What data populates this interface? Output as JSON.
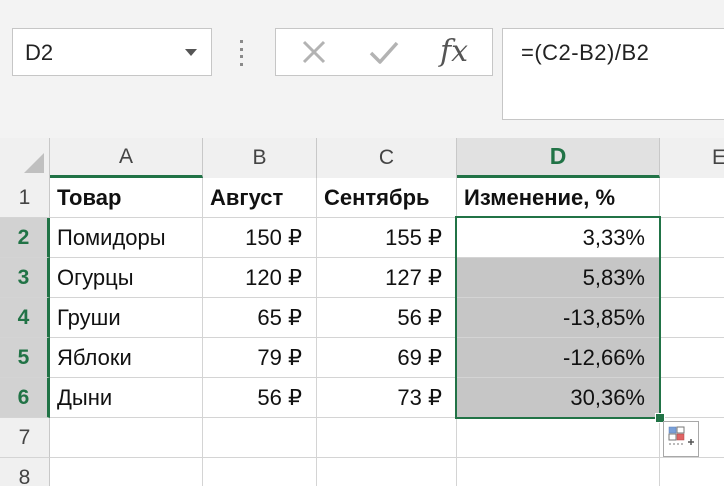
{
  "name_box": {
    "value": "D2"
  },
  "formula_bar": {
    "formula": "=(C2-B2)/B2",
    "cancel_icon": "cancel-x-icon",
    "enter_icon": "check-icon",
    "function_label": "fx"
  },
  "columns": [
    {
      "letter": "A"
    },
    {
      "letter": "B"
    },
    {
      "letter": "C"
    },
    {
      "letter": "D"
    },
    {
      "letter": "E"
    }
  ],
  "rows": [
    {
      "number": "1"
    },
    {
      "number": "2"
    },
    {
      "number": "3"
    },
    {
      "number": "4"
    },
    {
      "number": "5"
    },
    {
      "number": "6"
    },
    {
      "number": "7"
    },
    {
      "number": "8"
    }
  ],
  "table": {
    "headers": [
      "Товар",
      "Август",
      "Сентябрь",
      "Изменение, %"
    ],
    "data": [
      [
        "Помидоры",
        "150 ₽",
        "155 ₽",
        "3,33%"
      ],
      [
        "Огурцы",
        "120 ₽",
        "127 ₽",
        "5,83%"
      ],
      [
        "Груши",
        "65 ₽",
        "56 ₽",
        "-13,85%"
      ],
      [
        "Яблоки",
        "79 ₽",
        "69 ₽",
        "-12,66%"
      ],
      [
        "Дыни",
        "56 ₽",
        "73 ₽",
        "30,36%"
      ]
    ]
  },
  "selection": {
    "active_cell": "D2",
    "range": "D2:D6"
  },
  "colors": {
    "accent": "#217346",
    "selection_fill": "#c6c6c6"
  },
  "icons": {
    "quick_analysis": "quick-analysis-icon"
  }
}
